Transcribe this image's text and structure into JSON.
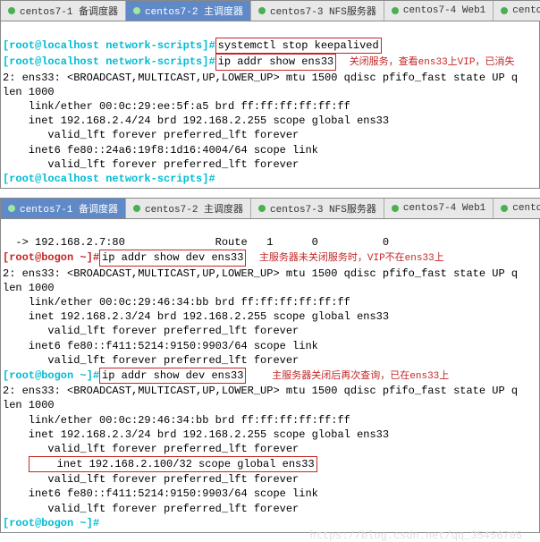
{
  "tabs": {
    "t1": "centos7-1 备调度器",
    "t2": "centos7-2 主调度器",
    "t3": "centos7-3 NFS服务器",
    "t4": "centos7-4 Web1",
    "t5": "centos",
    "plus": "+"
  },
  "top": {
    "prompt": "[root@localhost network-scripts]#",
    "cmd1": "systemctl stop keepalived",
    "cmd2": "ip addr show ens33",
    "note1": "关闭服务，查看ens33上VIP，已消失",
    "l1": "2: ens33: <BROADCAST,MULTICAST,UP,LOWER_UP> mtu 1500 qdisc pfifo_fast state UP q",
    "l2": "len 1000",
    "l3": "    link/ether 00:0c:29:ee:5f:a5 brd ff:ff:ff:ff:ff:ff",
    "l4": "    inet 192.168.2.4/24 brd 192.168.2.255 scope global ens33",
    "l5": "       valid_lft forever preferred_lft forever",
    "l6": "    inet6 fe80::24a6:19f8:1d16:4004/64 scope link",
    "l7": "       valid_lft forever preferred_lft forever"
  },
  "bot": {
    "prompt": "[root@bogon ~]#",
    "l0": "  -> 192.168.2.7:80              Route   1      0          0",
    "cmd1": "ip addr show dev ens33",
    "note1": "主服务器未关闭服务时，VIP不在ens33上",
    "l1": "2: ens33: <BROADCAST,MULTICAST,UP,LOWER_UP> mtu 1500 qdisc pfifo_fast state UP q",
    "l2": "len 1000",
    "l3": "    link/ether 00:0c:29:46:34:bb brd ff:ff:ff:ff:ff:ff",
    "l4": "    inet 192.168.2.3/24 brd 192.168.2.255 scope global ens33",
    "l5": "       valid_lft forever preferred_lft forever",
    "l6": "    inet6 fe80::f411:5214:9150:9903/64 scope link",
    "l7": "       valid_lft forever preferred_lft forever",
    "cmd2": "ip addr show dev ens33",
    "note2": "主服务器关闭后再次查询，已在ens33上",
    "b1": "2: ens33: <BROADCAST,MULTICAST,UP,LOWER_UP> mtu 1500 qdisc pfifo_fast state UP q",
    "b2": "len 1000",
    "b3": "    link/ether 00:0c:29:46:34:bb brd ff:ff:ff:ff:ff:ff",
    "b4": "    inet 192.168.2.3/24 brd 192.168.2.255 scope global ens33",
    "b5": "       valid_lft forever preferred_lft forever",
    "b6": "    inet 192.168.2.100/32 scope global ens33",
    "b7": "       valid_lft forever preferred_lft forever",
    "b8": "    inet6 fe80::f411:5214:9150:9903/64 scope link",
    "b9": "       valid_lft forever preferred_lft forever"
  },
  "watermark": "https://blog.csdn.net/qq_35456705"
}
